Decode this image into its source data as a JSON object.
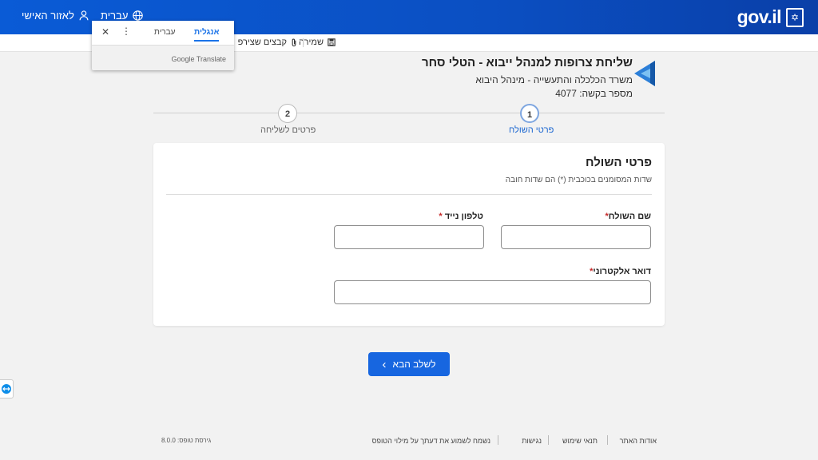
{
  "header": {
    "logo_text": "gov.il",
    "language_label": "עברית",
    "personal_area_label": "לאזור האישי"
  },
  "toolbar": {
    "save_label": "שמירה",
    "files_label": "קבצים שצירפ"
  },
  "translate_popup": {
    "tab_english": "אנגלית",
    "tab_hebrew": "עברית",
    "more_icon": "⋮",
    "close_icon": "✕",
    "brand": "Google Translate"
  },
  "form": {
    "title": "שליחת צרופות למנהל ייבוא - הטלי סחר",
    "ministry": "משרד הכלכלה והתעשייה - מינהל היבוא",
    "request_number": "מספר בקשה: 4077"
  },
  "stepper": {
    "steps": [
      {
        "number": "1",
        "label": "פרטי השולח",
        "active": true
      },
      {
        "number": "2",
        "label": "פרטים לשליחה",
        "active": false
      }
    ]
  },
  "card": {
    "title": "פרטי השולח",
    "note": "שדות המסומנים בכוכבית (*) הם שדות חובה",
    "fields": {
      "sender_name": {
        "label": "שם השולח",
        "value": ""
      },
      "mobile_phone": {
        "label": "טלפון נייד",
        "value": ""
      },
      "email": {
        "label": "דואר אלקטרוני",
        "value": ""
      }
    },
    "required_mark": "*"
  },
  "next_button": {
    "label": "לשלב הבא",
    "icon": "›"
  },
  "footer": {
    "links": [
      "אודות האתר",
      "תנאי שימוש",
      "נגישות",
      "נשמח לשמוע את דעתך על מילוי הטופס"
    ],
    "version": "גירסת טופס: 8.0.0"
  },
  "colors": {
    "brand_blue": "#0a5bd6",
    "button_blue": "#1766e0",
    "active_step": "#1a66d1",
    "required_red": "#c62828"
  }
}
